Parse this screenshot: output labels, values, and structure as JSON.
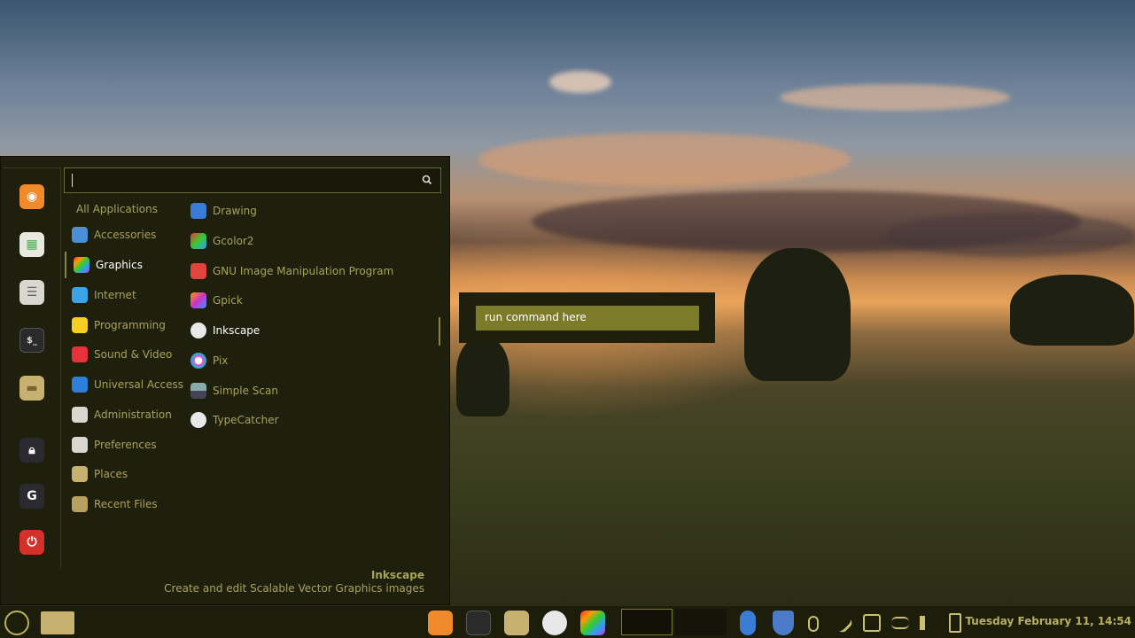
{
  "menu": {
    "search": {
      "value": ""
    },
    "favorites": [
      {
        "name": "firefox-icon"
      },
      {
        "name": "software-manager-icon"
      },
      {
        "name": "settings-icon"
      },
      {
        "name": "terminal-icon"
      },
      {
        "name": "folder-icon"
      },
      {
        "name": "lock-icon"
      },
      {
        "name": "logout-icon"
      },
      {
        "name": "power-icon"
      }
    ],
    "categories": [
      {
        "label": "All Applications"
      },
      {
        "label": "Accessories"
      },
      {
        "label": "Graphics"
      },
      {
        "label": "Internet"
      },
      {
        "label": "Programming"
      },
      {
        "label": "Sound & Video"
      },
      {
        "label": "Universal Access"
      },
      {
        "label": "Administration"
      },
      {
        "label": "Preferences"
      },
      {
        "label": "Places"
      },
      {
        "label": "Recent Files"
      }
    ],
    "apps": [
      {
        "label": "Drawing"
      },
      {
        "label": "Gcolor2"
      },
      {
        "label": "GNU Image Manipulation Program"
      },
      {
        "label": "Gpick"
      },
      {
        "label": "Inkscape"
      },
      {
        "label": "Pix"
      },
      {
        "label": "Simple Scan"
      },
      {
        "label": "TypeCatcher"
      }
    ],
    "selected_category": "Graphics",
    "description": {
      "title": "Inkscape",
      "text": "Create and edit Scalable Vector Graphics images"
    }
  },
  "run_dialog": {
    "value": "run command here"
  },
  "taskbar": {
    "clock": "Tuesday February 11, 14:54"
  },
  "colors": {
    "menu_bg": "#1f1f0e",
    "accent": "#a8a35a",
    "run_input_bg": "#7b7b2a"
  }
}
